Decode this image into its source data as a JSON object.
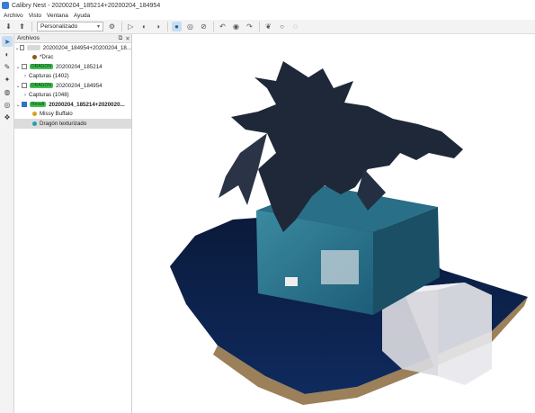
{
  "window": {
    "title": "Calibry Nest - 20200204_185214+20200204_184954"
  },
  "menu": [
    "Archivo",
    "Visto",
    "Ventana",
    "Ayuda"
  ],
  "toolbar": {
    "render_mode": "Personalizado"
  },
  "panel": {
    "title": "Archivos",
    "items": [
      {
        "label": "20200204_184954+20200204_18...",
        "tag": ""
      },
      {
        "label": "*Drac",
        "dot_color": "#8a5a14"
      },
      {
        "label": "20200204_185214",
        "tag": "DRAGON"
      },
      {
        "label": "Capturas (1402)"
      },
      {
        "label": "20200204_184954",
        "tag": "DRAGON"
      },
      {
        "label": "Capturas (1048)"
      },
      {
        "label": "20200204_185214+2020020...",
        "tag": "Result"
      },
      {
        "label": "Missy Buffalo",
        "dot_color": "#d9a21b"
      },
      {
        "label": "Dragón texturizado",
        "dot_color": "#2a9db1"
      }
    ]
  },
  "colors": {
    "accent": "#2b74c9",
    "tag_green": "#3fbf52",
    "selected_row": "#dcdcdc"
  },
  "icons": {
    "toolbar": [
      "import-icon",
      "export-icon",
      "settings-icon",
      "play-icon",
      "contrast-icon",
      "sphere-icon",
      "globe-icon",
      "no-texture-icon",
      "undo-icon",
      "record-icon",
      "redo-icon",
      "brain-icon",
      "circle-icon",
      "dotted-circle-icon"
    ],
    "sidebar": [
      "select-arrow-icon",
      "view-icon",
      "measure-icon",
      "pin-icon",
      "mesh-icon",
      "texture-icon",
      "stack-icon"
    ]
  }
}
